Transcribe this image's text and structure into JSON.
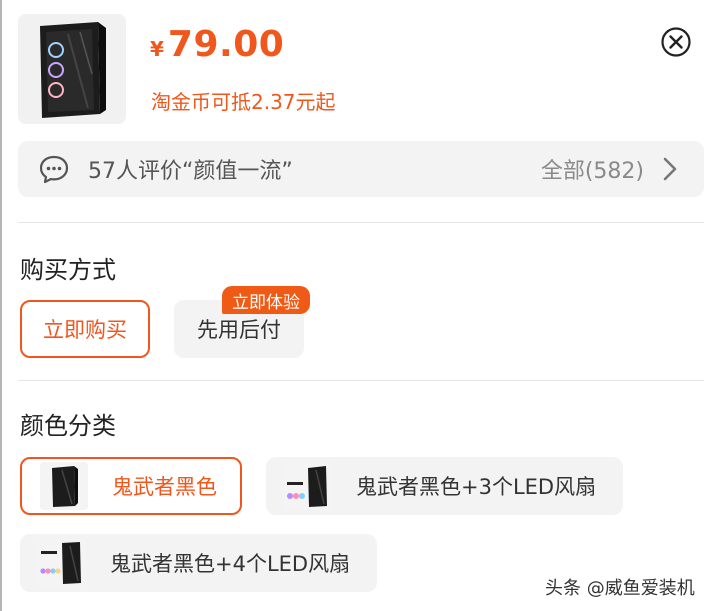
{
  "product": {
    "currency": "¥",
    "price": "79.00",
    "coin_text": "淘金币可抵2.37元起"
  },
  "reviews": {
    "summary": "57人评价“颜值一流”",
    "all_label": "全部(582)"
  },
  "purchase": {
    "title": "购买方式",
    "options": [
      {
        "label": "立即购买",
        "selected": true
      },
      {
        "label": "先用后付",
        "selected": false
      }
    ],
    "badge": "立即体验"
  },
  "color": {
    "title": "颜色分类",
    "options": [
      {
        "label": "鬼武者黑色",
        "selected": true
      },
      {
        "label": "鬼武者黑色+3个LED风扇",
        "selected": false
      },
      {
        "label": "鬼武者黑色+4个LED风扇",
        "selected": false
      }
    ]
  },
  "watermark": "头条 @威鱼爱装机",
  "colors": {
    "accent": "#f0571c",
    "option_bg": "#f3f3f3"
  }
}
